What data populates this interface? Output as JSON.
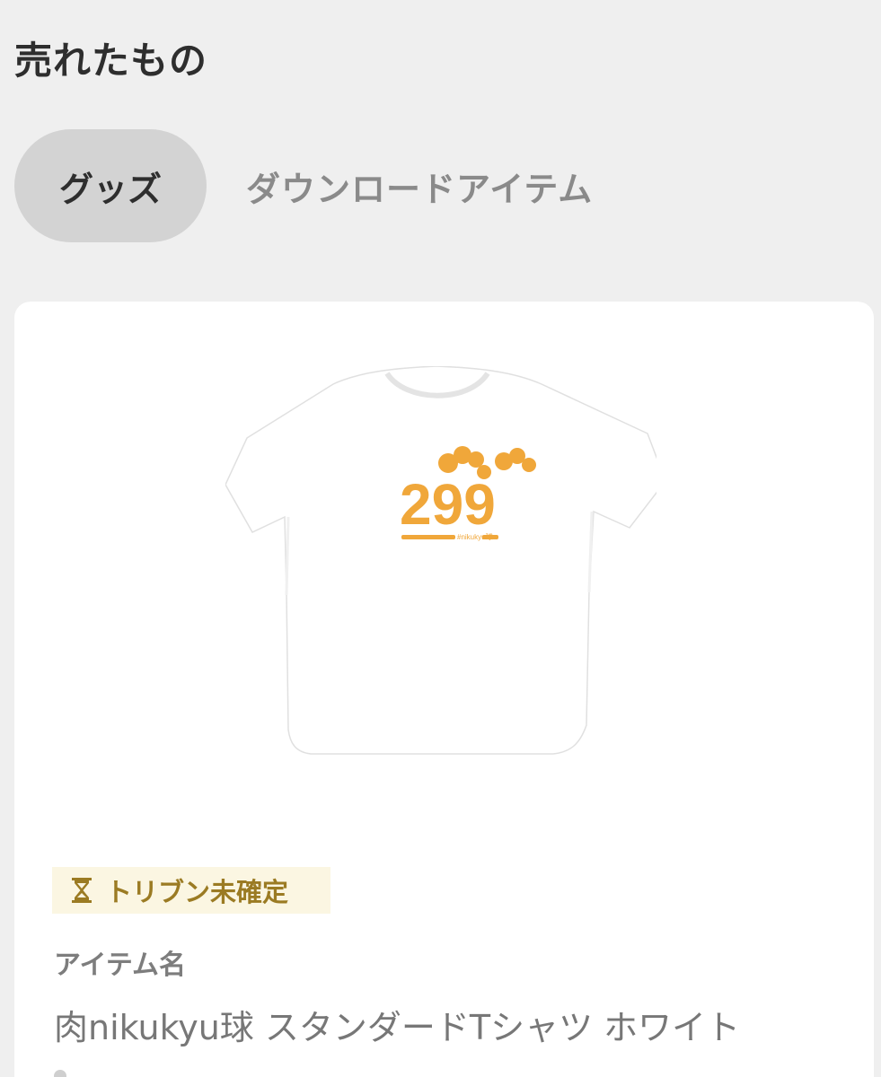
{
  "page": {
    "title": "売れたもの"
  },
  "tabs": [
    {
      "label": "グッズ",
      "active": true
    },
    {
      "label": "ダウンロードアイテム",
      "active": false
    }
  ],
  "item": {
    "image": {
      "subject": "white t-shirt",
      "print_text": "299",
      "print_subtext": "#nikukyu球",
      "print_color": "#f0a73a"
    },
    "status": {
      "icon": "hourglass-icon",
      "label": "トリブン未確定",
      "color": "#9b7b23",
      "background": "#fbf6e2"
    },
    "name_label": "アイテム名",
    "name_value": "肉nikukyu球 スタンダードTシャツ ホワイト"
  },
  "colors": {
    "background": "#efefef",
    "card": "#ffffff",
    "tab_active": "#d3d3d3"
  }
}
